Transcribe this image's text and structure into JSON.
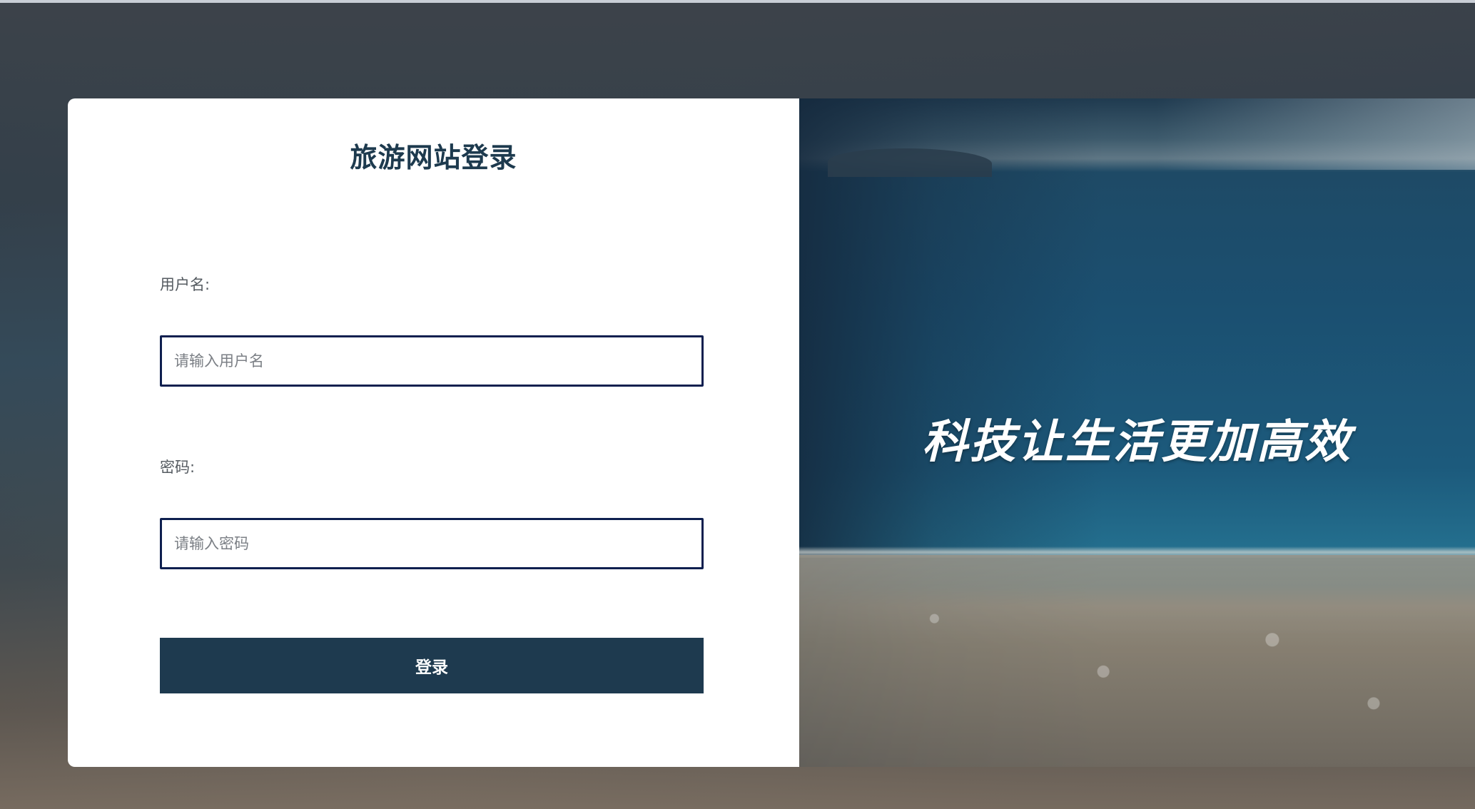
{
  "login": {
    "title": "旅游网站登录",
    "username_label": "用户名:",
    "username_placeholder": "请输入用户名",
    "password_label": "密码:",
    "password_placeholder": "请输入密码",
    "submit_label": "登录"
  },
  "hero": {
    "slogan": "科技让生活更加高效"
  },
  "colors": {
    "accent": "#1e3a4f",
    "input_border": "#0e1f4f",
    "title": "#1d3a4e"
  }
}
